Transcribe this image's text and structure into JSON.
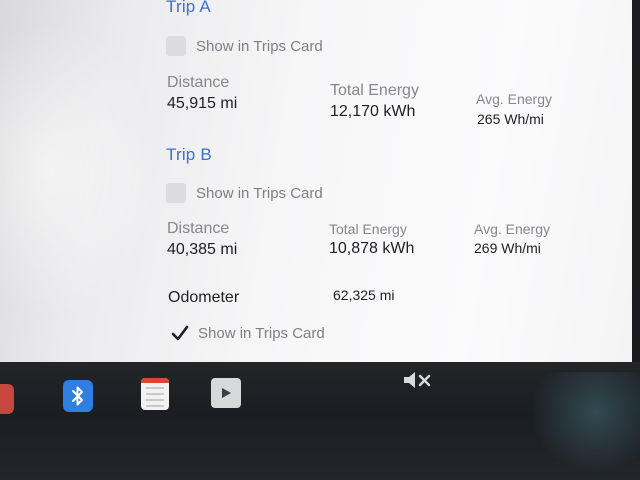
{
  "trip_a": {
    "title": "Trip A",
    "show_label": "Show in Trips Card",
    "show_checked": false,
    "distance_label": "Distance",
    "distance_value": "45,915 mi",
    "energy_label": "Total Energy",
    "energy_value": "12,170 kWh",
    "avg_label": "Avg. Energy",
    "avg_value": "265 Wh/mi"
  },
  "trip_b": {
    "title": "Trip B",
    "show_label": "Show in Trips Card",
    "show_checked": false,
    "distance_label": "Distance",
    "distance_value": "40,385 mi",
    "energy_label": "Total Energy",
    "energy_value": "10,878 kWh",
    "avg_label": "Avg. Energy",
    "avg_value": "269 Wh/mi"
  },
  "odometer": {
    "label": "Odometer",
    "value": "62,325 mi",
    "show_label": "Show in Trips Card",
    "show_checked": true
  },
  "dock": {
    "icons": [
      "app-icon",
      "bluetooth-icon",
      "calendar-icon",
      "media-icon",
      "volume-mute-icon"
    ]
  },
  "colors": {
    "accent": "#3d6fd6",
    "bluetooth": "#2f7fe3"
  }
}
